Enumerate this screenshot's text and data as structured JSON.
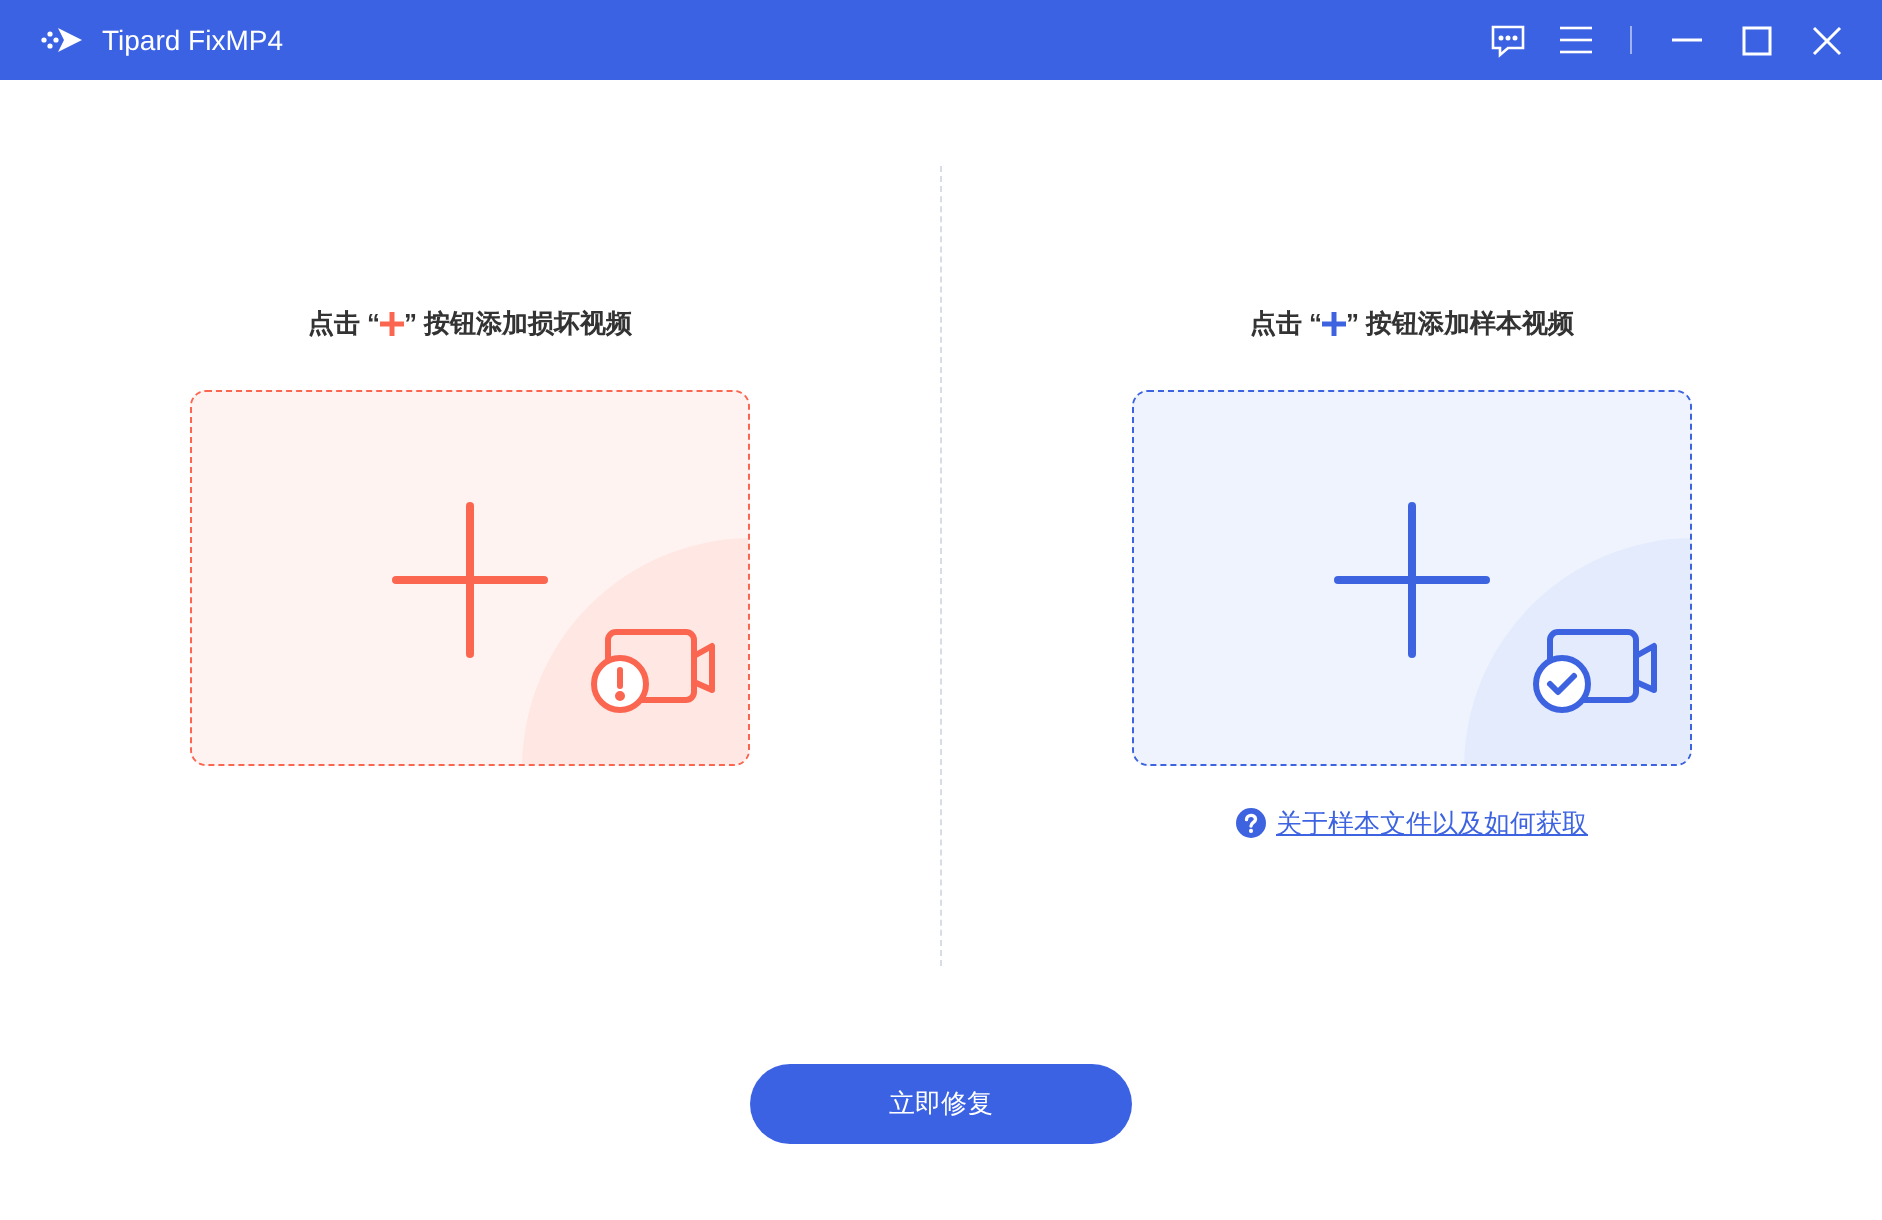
{
  "window": {
    "title": "Tipard FixMP4"
  },
  "panels": [
    {
      "kind": "damaged",
      "heading_before": "点击 “",
      "heading_after": "” 按钮添加损坏视频"
    },
    {
      "kind": "sample",
      "heading_before": "点击 “",
      "heading_after": "” 按钮添加样本视频",
      "help_link": "关于样本文件以及如何获取"
    }
  ],
  "repair_button": "立即修复"
}
